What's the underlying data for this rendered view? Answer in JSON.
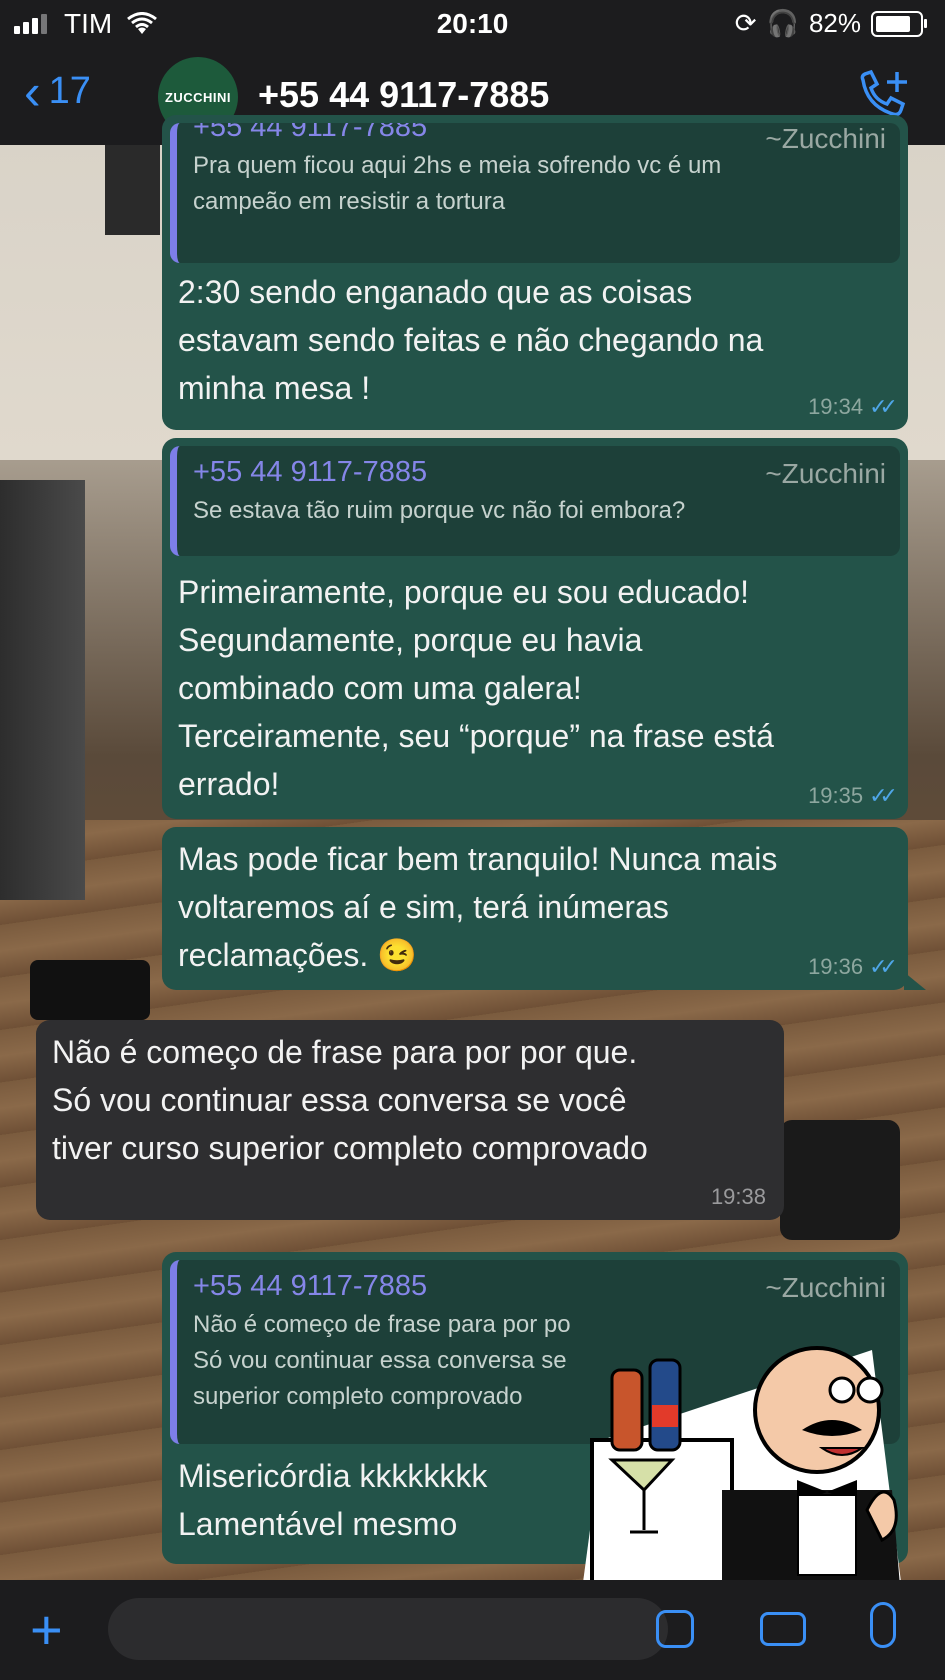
{
  "status_bar": {
    "carrier": "TIM",
    "time": "20:10",
    "battery": "82%"
  },
  "header": {
    "back_count": "17",
    "avatar_text": "ZUCCHINI",
    "contact_name": "+55 44 9117-7885"
  },
  "messages": [
    {
      "quote_name": "+55 44 9117-7885",
      "quote_tag": "~Zucchini",
      "quote_text": "Pra quem ficou aqui 2hs e meia sofrendo vc é um\ncampeão em resistir a tortura",
      "text": "2:30 sendo enganado que as coisas\nestavam sendo feitas e não chegando na\nminha mesa !",
      "time": "19:34"
    },
    {
      "quote_name": "+55 44 9117-7885",
      "quote_tag": "~Zucchini",
      "quote_text": "Se estava tão ruim porque vc não foi embora?",
      "text": "Primeiramente, porque eu sou educado!\nSegundamente, porque eu havia\ncombinado com uma galera!\nTerceiramente, seu “porque” na frase está\nerrado!",
      "time": "19:35"
    },
    {
      "text": "Mas pode ficar bem tranquilo! Nunca mais\nvoltaremos aí e sim, terá inúmeras\nreclamações. 😉",
      "time": "19:36"
    },
    {
      "text": "Não é começo de frase para por por que.\nSó vou continuar essa conversa se você\ntiver curso superior completo comprovado",
      "time": "19:38"
    },
    {
      "quote_name": "+55 44 9117-7885",
      "quote_tag": "~Zucchini",
      "quote_text": "Não é começo de frase para por po\nSó vou continuar essa conversa se\nsuperior completo comprovado",
      "text": "Misericórdia kkkkkkkk\nLamentável mesmo"
    }
  ],
  "colors": {
    "outgoing_bubble": "#235349",
    "incoming_bubble": "#2e2e30",
    "accent": "#3a8ff5",
    "quote_name": "#8586e8",
    "read_ticks": "#4fa6e8"
  },
  "icons": [
    "signal-icon",
    "wifi-icon",
    "orientation-lock-icon",
    "headphones-icon",
    "battery-icon",
    "back-chevron-icon",
    "add-call-icon",
    "plus-icon",
    "sticker-icon",
    "camera-icon",
    "microphone-icon"
  ]
}
